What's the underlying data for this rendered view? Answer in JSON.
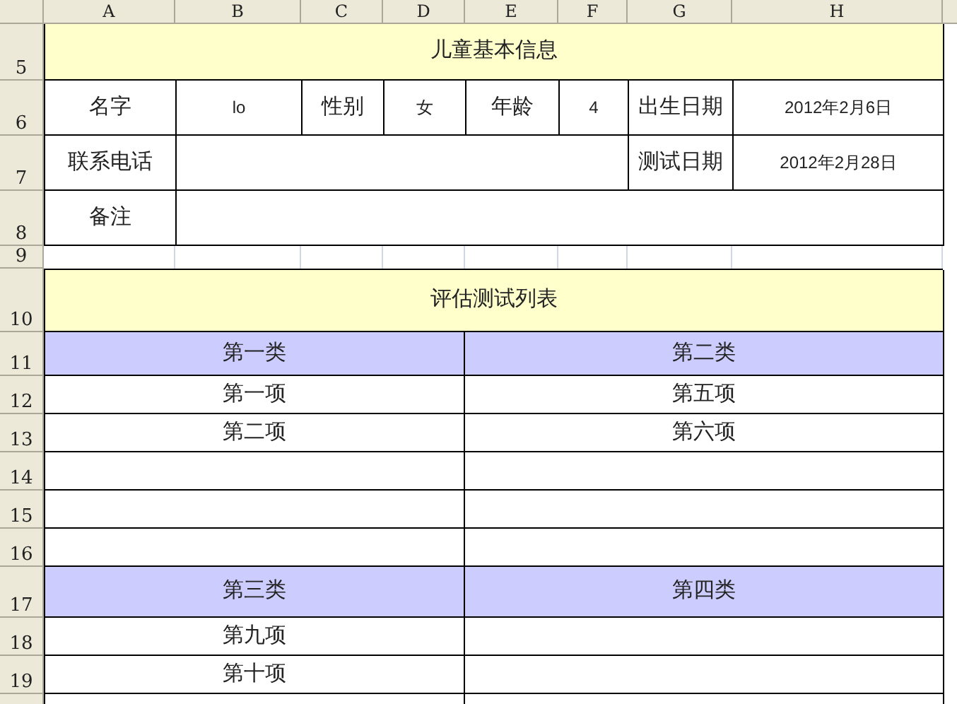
{
  "column_headers": [
    "A",
    "B",
    "C",
    "D",
    "E",
    "F",
    "G",
    "H"
  ],
  "row_numbers": [
    "5",
    "6",
    "7",
    "8",
    "9",
    "10",
    "11",
    "12",
    "13",
    "14",
    "15",
    "16",
    "17",
    "18",
    "19"
  ],
  "info_title": "儿童基本信息",
  "info": {
    "name_label": "名字",
    "name": "lo",
    "gender_label": "性别",
    "gender": "女",
    "age_label": "年龄",
    "age": "4",
    "birth_label": "出生日期",
    "birth_date": "2012年2月6日",
    "phone_label": "联系电话",
    "test_date_label": "测试日期",
    "test_date": "2012年2月28日",
    "note_label": "备注"
  },
  "test_list_title": "评估测试列表",
  "groups": [
    {
      "categories": [
        {
          "name": "第一类",
          "items": [
            "第一项",
            "第二项"
          ]
        },
        {
          "name": "第二类",
          "items": [
            "第五项",
            "第六项"
          ]
        }
      ]
    },
    {
      "categories": [
        {
          "name": "第三类",
          "items": [
            "第九项",
            "第十项"
          ]
        },
        {
          "name": "第四类"
        }
      ]
    }
  ]
}
